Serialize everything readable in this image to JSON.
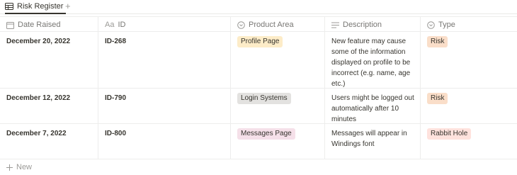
{
  "tab": {
    "icon": "table-icon",
    "label": "Risk Register",
    "add": "+"
  },
  "columns": [
    {
      "key": "date",
      "label": "Date Raised",
      "icon": "calendar-icon"
    },
    {
      "key": "id",
      "label": "ID",
      "icon": "text-property-icon",
      "icon_text": "Aa"
    },
    {
      "key": "area",
      "label": "Product Area",
      "icon": "select-icon"
    },
    {
      "key": "desc",
      "label": "Description",
      "icon": "lines-icon"
    },
    {
      "key": "type",
      "label": "Type",
      "icon": "select-icon"
    }
  ],
  "rows": [
    {
      "date": "December 20, 2022",
      "id": "ID-268",
      "area": "Profile Page",
      "area_color": "#fdecc8",
      "desc": "New feature may cause some of the information displayed on profile to be incorrect (e.g. name, age etc.)",
      "type": "Risk",
      "type_color": "#fadec9"
    },
    {
      "date": "December 12, 2022",
      "id": "ID-790",
      "area": "Login Systems",
      "area_color": "#e3e2e0",
      "desc": "Users might be logged out automatically after 10 minutes",
      "type": "Risk",
      "type_color": "#fadec9"
    },
    {
      "date": "December 7, 2022",
      "id": "ID-800",
      "area": "Messages Page",
      "area_color": "#f5e0e9",
      "desc": "Messages will appear in Windings font",
      "type": "Rabbit Hole",
      "type_color": "#ffe2dd"
    }
  ],
  "new_row": {
    "icon": "plus-icon",
    "label": "New"
  }
}
